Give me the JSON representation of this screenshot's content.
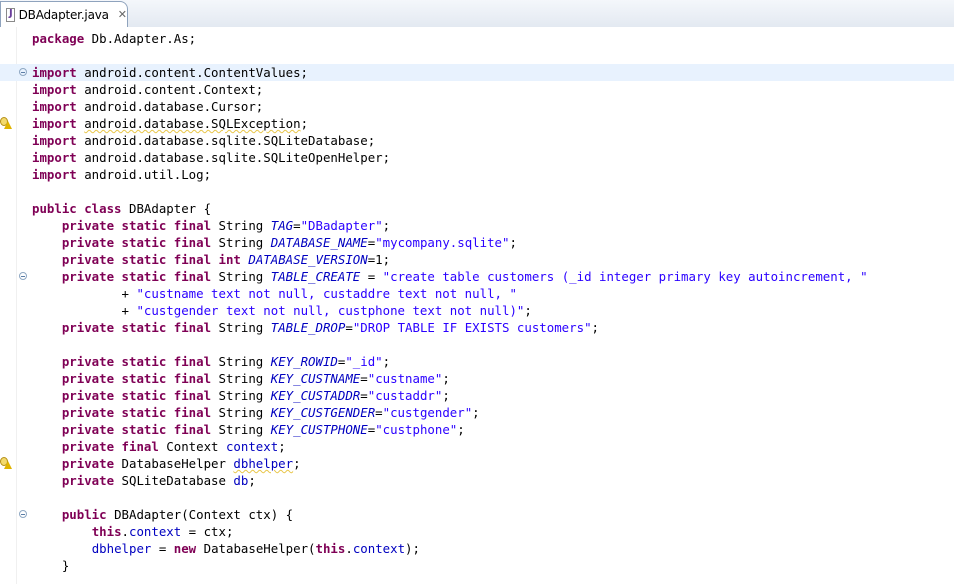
{
  "tab": {
    "title": "DBAdapter.java",
    "close": "✕"
  },
  "code": {
    "l1_kw": "package",
    "l1_rest": " Db.Adapter.As;",
    "imp": "import",
    "i1": " android.content.ContentValues;",
    "i2": " android.content.Context;",
    "i3": " android.database.Cursor;",
    "i4a": " ",
    "i4b": "android.database.SQLException",
    "i4c": ";",
    "i5": " android.database.sqlite.SQLiteDatabase;",
    "i6": " android.database.sqlite.SQLiteOpenHelper;",
    "i7": " android.util.Log;",
    "c_public_class": "public class",
    "c_name": " DBAdapter {",
    "psf": "private static final",
    "psfs_type": " String ",
    "psfi_type": " int ",
    "f_tag": "TAG",
    "v_tag": "\"DBadapter\"",
    "f_dbname": "DATABASE_NAME",
    "v_dbname": "\"mycompany.sqlite\"",
    "f_dbver": "DATABASE_VERSION",
    "v_dbver": "=1;",
    "f_tcreate": "TABLE_CREATE",
    "v_tcreate1": "\"create table customers (_id integer primary key autoincrement, \"",
    "v_tcreate2": "\"custname text not null, custaddre text not null, \"",
    "v_tcreate3": "\"custgender text not null, custphone text not null)\"",
    "plus": "+ ",
    "f_tdrop": "TABLE_DROP",
    "v_tdrop": "\"DROP TABLE IF EXISTS customers\"",
    "f_rowid": "KEY_ROWID",
    "v_rowid": "\"_id\"",
    "f_custname": "KEY_CUSTNAME",
    "v_custname": "\"custname\"",
    "f_custaddr": "KEY_CUSTADDR",
    "v_custaddr": "\"custaddr\"",
    "f_custgender": "KEY_CUSTGENDER",
    "v_custgender": "\"custgender\"",
    "f_custphone": "KEY_CUSTPHONE",
    "v_custphone": "\"custphone\"",
    "pf": "private final",
    "ctx_type": " Context ",
    "ctx_field": "context",
    "p": "private",
    "dbh_type": " DatabaseHelper ",
    "dbh_field": "dbhelper",
    "db_type": " SQLiteDatabase ",
    "db_field": "db",
    "pub": "public",
    "ctor": " DBAdapter(Context ctx) {",
    "this": "this",
    "ctx_assign": " = ctx;",
    "new_kw": "new",
    "dbh_assign_a": " = ",
    "dbh_assign_b": " DatabaseHelper(",
    "dbh_assign_c": ");",
    "close_brace": "}",
    "eq": "=",
    "eq_sp": " = ",
    "semi": ";",
    "close_paren_semi": ";",
    "tail": ");",
    "dot": "."
  }
}
